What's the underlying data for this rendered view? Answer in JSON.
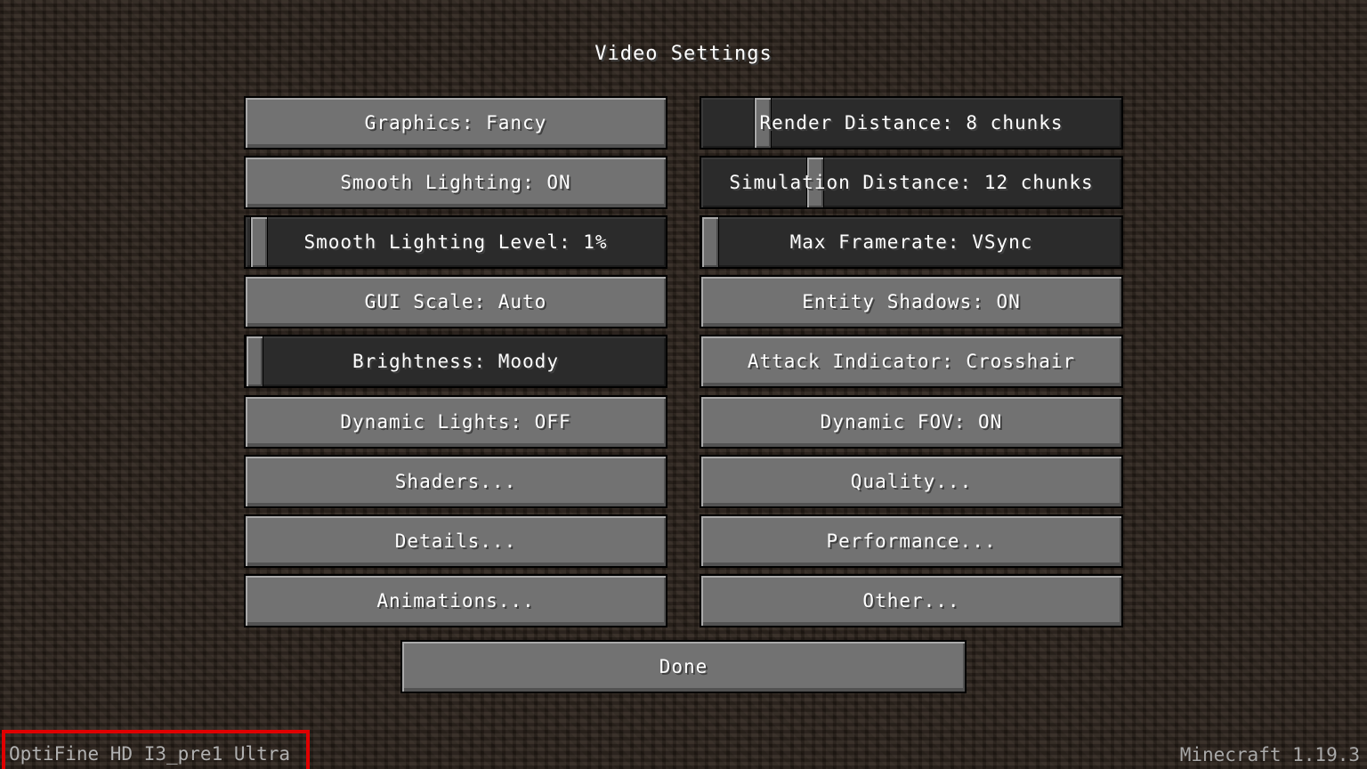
{
  "screen": {
    "title": "Video Settings"
  },
  "left_column": [
    {
      "kind": "button",
      "label": "Graphics: Fancy"
    },
    {
      "kind": "button",
      "label": "Smooth Lighting: ON"
    },
    {
      "kind": "slider",
      "label": "Smooth Lighting Level: 1%",
      "value": 0.01
    },
    {
      "kind": "button",
      "label": "GUI Scale: Auto"
    },
    {
      "kind": "slider",
      "label": "Brightness: Moody",
      "value": 0.0
    },
    {
      "kind": "button",
      "label": "Dynamic Lights: OFF"
    },
    {
      "kind": "button",
      "label": "Shaders..."
    },
    {
      "kind": "button",
      "label": "Details..."
    },
    {
      "kind": "button",
      "label": "Animations..."
    }
  ],
  "right_column": [
    {
      "kind": "slider",
      "label": "Render Distance: 8 chunks",
      "value": 0.13
    },
    {
      "kind": "slider",
      "label": "Simulation Distance: 12 chunks",
      "value": 0.26
    },
    {
      "kind": "slider",
      "label": "Max Framerate: VSync",
      "value": 0.0
    },
    {
      "kind": "button",
      "label": "Entity Shadows: ON"
    },
    {
      "kind": "button",
      "label": "Attack Indicator: Crosshair"
    },
    {
      "kind": "button",
      "label": "Dynamic FOV: ON"
    },
    {
      "kind": "button",
      "label": "Quality..."
    },
    {
      "kind": "button",
      "label": "Performance..."
    },
    {
      "kind": "button",
      "label": "Other..."
    }
  ],
  "done_button": {
    "label": "Done"
  },
  "footer": {
    "left": "OptiFine HD I3_pre1 Ultra",
    "right": "Minecraft 1.19.3"
  },
  "colors": {
    "highlight_box": "#e00000",
    "button_face": "#727272",
    "slider_track": "#2b2b2b"
  }
}
